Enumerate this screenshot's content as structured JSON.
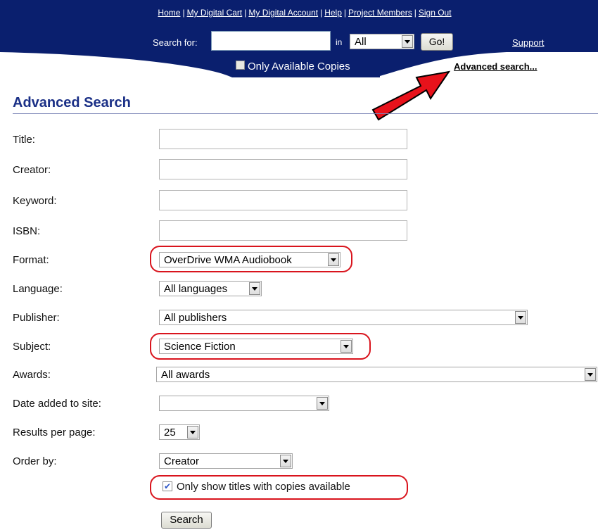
{
  "header": {
    "links": [
      "Home",
      "My Digital Cart",
      "My Digital Account",
      "Help",
      "Project Members",
      "Sign Out"
    ],
    "search_label": "Search for:",
    "search_value": "",
    "in_label": "in",
    "scope_selected": "All",
    "go_label": "Go!",
    "support_label": "Support",
    "only_available_label": "Only Available Copies",
    "only_available_checked": false,
    "advanced_link": "Advanced search..."
  },
  "page": {
    "title": "Advanced Search"
  },
  "form": {
    "title_label": "Title:",
    "creator_label": "Creator:",
    "keyword_label": "Keyword:",
    "isbn_label": "ISBN:",
    "format_label": "Format:",
    "format_value": "OverDrive WMA Audiobook",
    "language_label": "Language:",
    "language_value": "All languages",
    "publisher_label": "Publisher:",
    "publisher_value": "All publishers",
    "subject_label": "Subject:",
    "subject_value": "Science Fiction",
    "awards_label": "Awards:",
    "awards_value": "All awards",
    "date_label": "Date added to site:",
    "date_value": "",
    "results_label": "Results per page:",
    "results_value": "25",
    "order_label": "Order by:",
    "order_value": "Creator",
    "copies_label": "Only show titles with copies available",
    "copies_checked": true,
    "search_button": "Search"
  },
  "colors": {
    "header_bg": "#0a1f6e",
    "title": "#1a2f86",
    "highlight": "#d9141d",
    "arrow": "#e8121b"
  }
}
